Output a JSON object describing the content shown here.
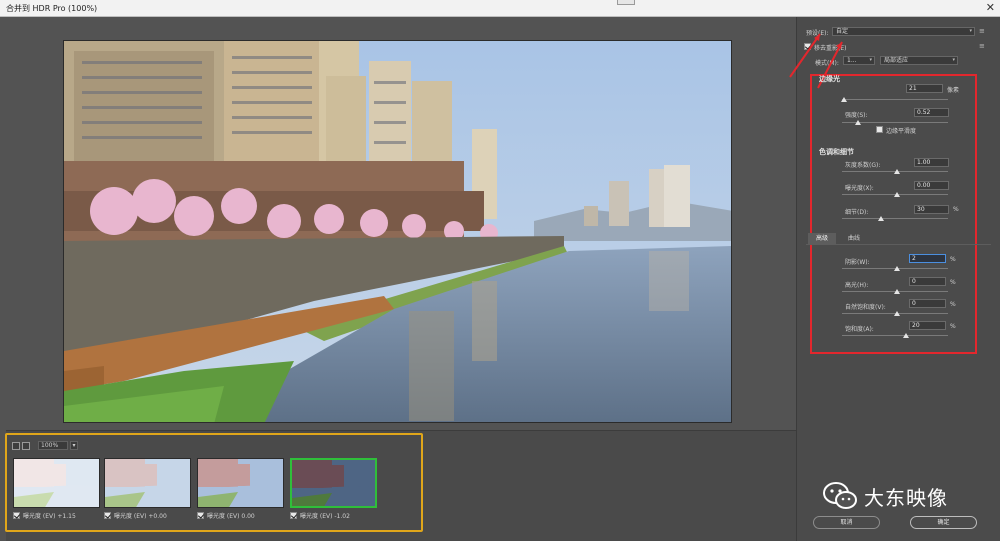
{
  "window": {
    "title": "合并到 HDR Pro (100%)"
  },
  "filmstrip": {
    "zoom": "100%",
    "thumbnails": [
      {
        "label": "曝光度 (EV) +1.15",
        "checked": true,
        "active": false,
        "tone": "bright"
      },
      {
        "label": "曝光度 (EV) +0.00",
        "checked": true,
        "active": false,
        "tone": "light"
      },
      {
        "label": "曝光度 (EV) 0.00",
        "checked": true,
        "active": false,
        "tone": "normal"
      },
      {
        "label": "曝光度 (EV) -1.02",
        "checked": true,
        "active": true,
        "tone": "dark"
      }
    ]
  },
  "panel": {
    "preset_label": "预设(E):",
    "preset_value": "自定",
    "remove_ghosts": "移去重影(E)",
    "mode_label": "模式(M):",
    "mode_value": "1...",
    "method_value": "局部适应",
    "edge_glow": {
      "title": "边缘光",
      "radius_value": "21",
      "radius_unit": "像素",
      "strength_label": "强度(S):",
      "strength_value": "0.52",
      "smooth_edges": "边缘平滑度"
    },
    "tone_detail": {
      "title": "色调和细节",
      "gamma_label": "灰度系数(G):",
      "gamma_value": "1.00",
      "exposure_label": "曝光度(X):",
      "exposure_value": "0.00",
      "detail_label": "细节(D):",
      "detail_value": "30",
      "detail_unit": "%"
    },
    "tabs": [
      "高级",
      "曲线"
    ],
    "advanced": {
      "shadow_label": "阴影(W):",
      "shadow_value": "2",
      "highlight_label": "高光(H):",
      "highlight_value": "0",
      "vibrance_label": "自然饱和度(V):",
      "vibrance_value": "0",
      "saturation_label": "饱和度(A):",
      "saturation_value": "20",
      "unit": "%"
    }
  },
  "buttons": {
    "cancel": "取消",
    "ok": "确定"
  },
  "watermark": {
    "text": "大东映像"
  },
  "colors": {
    "highlight_box": "#e3272d",
    "filmstrip_box": "#e0a61a",
    "active_thumb": "#2fbf3a"
  }
}
